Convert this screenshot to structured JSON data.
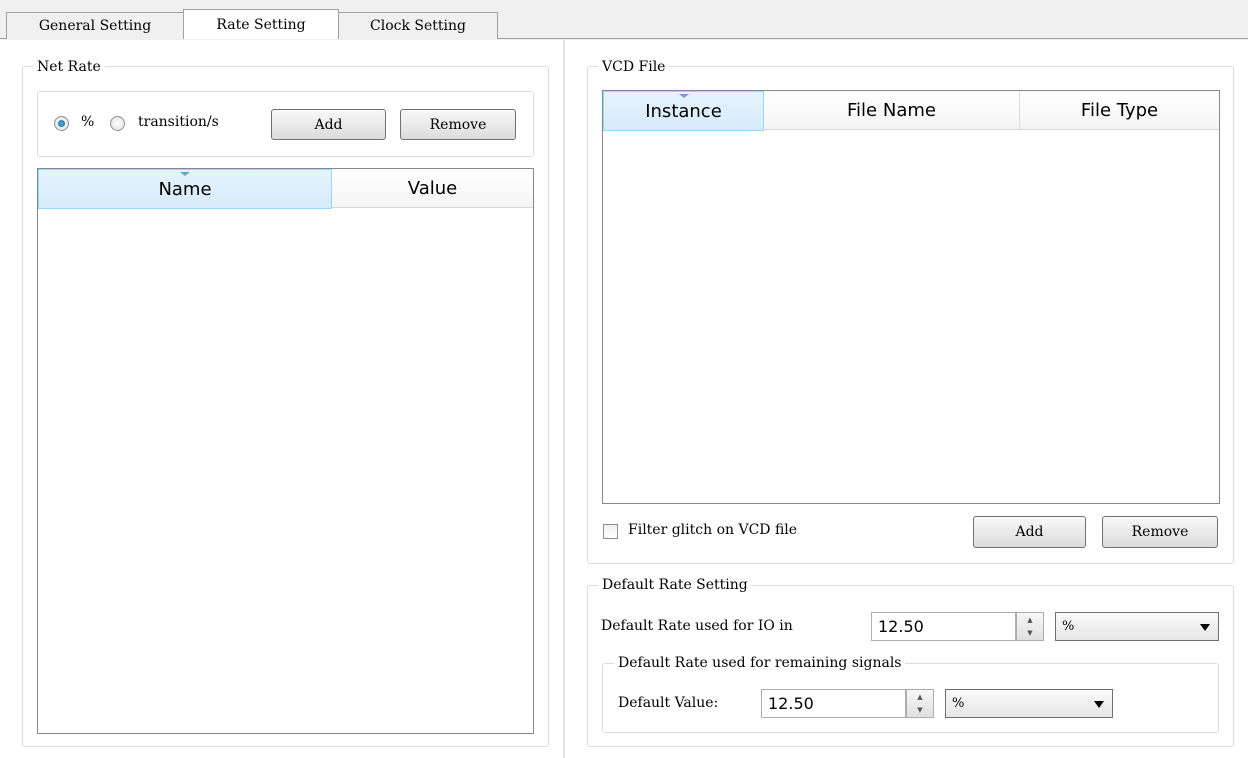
{
  "tabs": [
    {
      "label": "General Setting",
      "active": false
    },
    {
      "label": "Rate Setting",
      "active": true
    },
    {
      "label": "Clock Setting",
      "active": false
    }
  ],
  "net_rate": {
    "title": "Net Rate",
    "radio_percent_label": "%",
    "radio_transition_label": "transition/s",
    "selected": "%",
    "add_label": "Add",
    "remove_label": "Remove",
    "columns": [
      "Name",
      "Value"
    ],
    "rows": []
  },
  "vcd_file": {
    "title": "VCD File",
    "columns": [
      "Instance",
      "File Name",
      "File Type"
    ],
    "rows": [],
    "filter_label": "Filter glitch on VCD file",
    "filter_checked": false,
    "add_label": "Add",
    "remove_label": "Remove"
  },
  "default_rate": {
    "title": "Default Rate Setting",
    "io_label": "Default Rate used for IO in",
    "io_value": "12.50",
    "io_unit": "%",
    "remaining_title": "Default Rate used for remaining signals",
    "default_value_label": "Default Value:",
    "default_value": "12.50",
    "default_unit": "%"
  },
  "colors": {
    "sorted_header": "#d6ebfa",
    "sorted_border": "#96d9f9",
    "radio_selected": "#1c5c9a"
  }
}
